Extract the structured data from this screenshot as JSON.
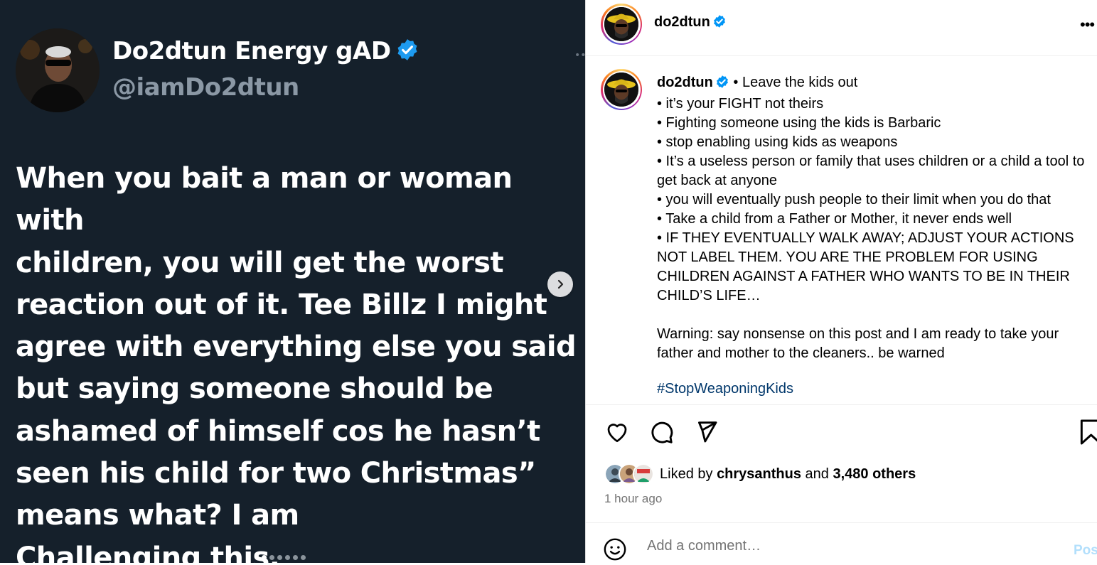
{
  "tweet": {
    "display_name": "Do2dtun Energy gAD",
    "handle": "@iamDo2dtun",
    "text": "When you bait a man or woman with\nchildren, you will get the worst\nreaction out of it. Tee Billz I might\nagree with everything else you said\nbut saying someone should be\nashamed of himself cos he hasn’t\nseen his child for two Christmas”\nmeans what? I am\nChallenging this."
  },
  "carousel": {
    "total": 6,
    "active_index": 0
  },
  "post": {
    "header_username": "do2dtun",
    "caption_username": "do2dtun",
    "caption_text": " • Leave the kids out\n• it’s your FIGHT not theirs\n• Fighting someone using the kids is Barbaric\n• stop enabling using kids as weapons\n• It’s a useless person or family that uses children or a child a tool to get back at anyone\n• you will eventually push people to their limit when you do that\n• Take a child from a Father or Mother, it never ends well\n• IF THEY EVENTUALLY WALK AWAY; ADJUST YOUR ACTIONS NOT LABEL THEM. YOU ARE THE PROBLEM FOR USING CHILDREN AGAINST A FATHER WHO WANTS TO BE IN THEIR CHILD’S LIFE…\n\nWarning: say nonsense on this post and I am ready to take your father and mother to the cleaners.. be warned",
    "hashtag": "#StopWeaponingKids",
    "likes_prefix": "Liked by ",
    "liked_by_user": "chrysanthus",
    "likes_joiner": " and ",
    "others_count": "3,480 others",
    "time_ago": "1 hour ago",
    "comment_placeholder": "Add a comment…",
    "post_button": "Post"
  },
  "icons": [
    "verified-badge-icon",
    "more-icon",
    "heart-icon",
    "comment-icon",
    "share-icon",
    "bookmark-icon",
    "emoji-icon",
    "chevron-right-icon"
  ],
  "colors": {
    "tweet_bg": "#15202b",
    "verified_blue": "#1d9bf0",
    "hashtag": "#00376b",
    "post_button": "#b2dffc"
  }
}
